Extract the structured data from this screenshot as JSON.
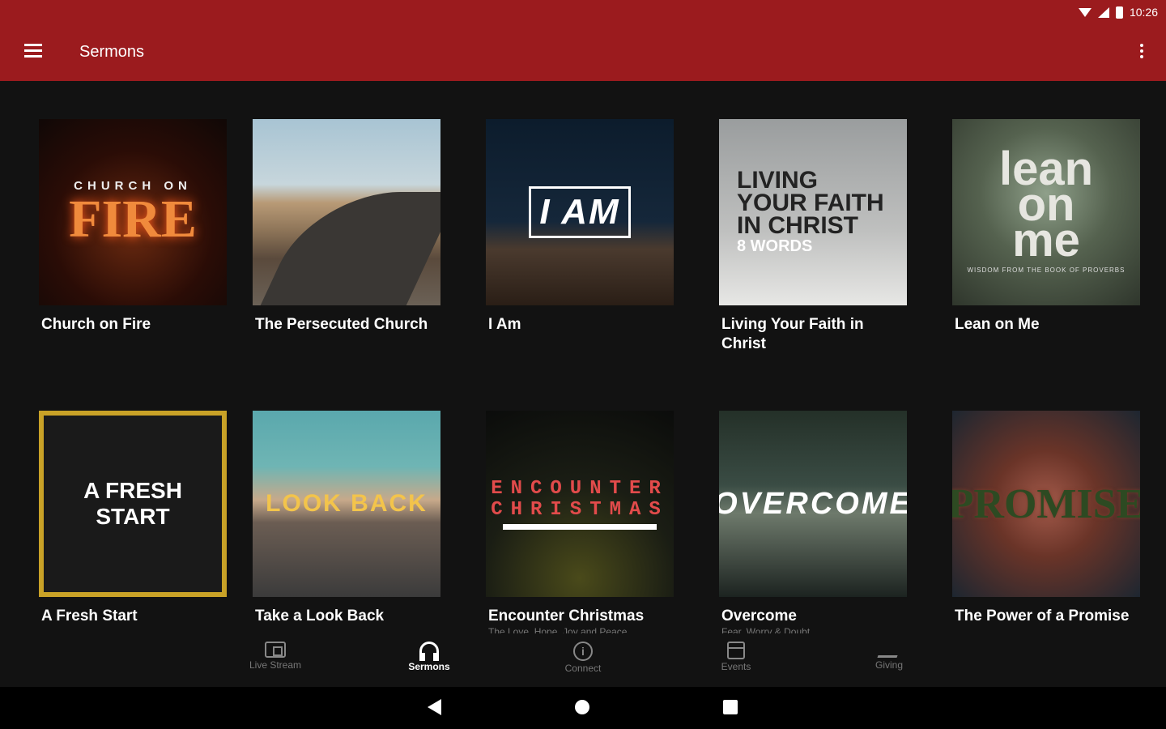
{
  "status_bar": {
    "time": "10:26"
  },
  "app_bar": {
    "title": "Sermons",
    "menu_icon": "hamburger-icon",
    "overflow_icon": "more-vert-icon"
  },
  "sermons": [
    {
      "title": "Church on Fire",
      "art": {
        "line1": "CHURCH ON",
        "line2": "FIRE"
      }
    },
    {
      "title": "The Persecuted Church",
      "art": {}
    },
    {
      "title": "I Am",
      "art": {
        "text": "I AM"
      }
    },
    {
      "title": "Living Your Faith in Christ",
      "art": {
        "line1": "LIVING",
        "line2": "YOUR FAITH",
        "line3": "IN CHRIST",
        "line4": "8 WORDS"
      }
    },
    {
      "title": "Lean on Me",
      "art": {
        "line1": "lean",
        "line2": "on",
        "line3": "me",
        "tagline": "WISDOM FROM THE BOOK OF PROVERBS"
      }
    },
    {
      "title": "A Fresh Start",
      "art": {
        "text": "A FRESH START"
      }
    },
    {
      "title": "Take a Look Back",
      "art": {
        "text": "LOOK BACK"
      }
    },
    {
      "title": "Encounter Christmas",
      "subtitle": "The Love, Hope, Joy and Peace",
      "art": {
        "line1": "ENCOUNTER",
        "line2": "CHRISTMAS"
      }
    },
    {
      "title": "Overcome",
      "subtitle": "Fear, Worry & Doubt",
      "art": {
        "text": "OVERCOME"
      }
    },
    {
      "title": "The Power of a Promise",
      "art": {
        "text": "PROMISE"
      }
    }
  ],
  "bottom_nav": [
    {
      "label": "Live Stream",
      "icon": "tv-icon"
    },
    {
      "label": "Sermons",
      "icon": "headphones-icon",
      "active": true
    },
    {
      "label": "Connect",
      "icon": "info-icon"
    },
    {
      "label": "Events",
      "icon": "calendar-icon"
    },
    {
      "label": "Giving",
      "icon": "giving-icon"
    }
  ]
}
